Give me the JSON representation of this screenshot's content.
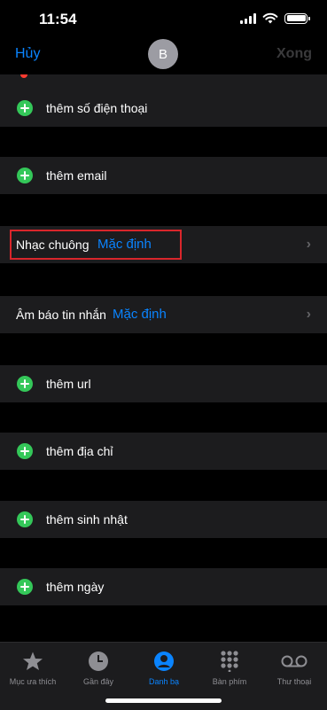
{
  "status_bar": {
    "time": "11:54"
  },
  "nav": {
    "cancel": "Hủy",
    "avatar_initial": "B",
    "done": "Xong"
  },
  "rows": {
    "add_phone": "thêm số điện thoại",
    "add_email": "thêm email",
    "ringtone_label": "Nhạc chuông",
    "ringtone_value": "Mặc định",
    "text_tone_label": "Âm báo tin nhắn",
    "text_tone_value": "Mặc định",
    "add_url": "thêm url",
    "add_address": "thêm địa chỉ",
    "add_birthday": "thêm sinh nhật",
    "add_date": "thêm ngày"
  },
  "tabs": [
    {
      "label": "Mục ưa thích",
      "icon": "star-icon"
    },
    {
      "label": "Gần đây",
      "icon": "clock-icon"
    },
    {
      "label": "Danh bạ",
      "icon": "contact-icon",
      "active": true
    },
    {
      "label": "Bàn phím",
      "icon": "keypad-icon"
    },
    {
      "label": "Thư thoại",
      "icon": "voicemail-icon"
    }
  ],
  "colors": {
    "accent": "#0a84ff",
    "add_green": "#34c759",
    "highlight_red": "#d9262b",
    "row_bg": "#1c1c1e"
  }
}
